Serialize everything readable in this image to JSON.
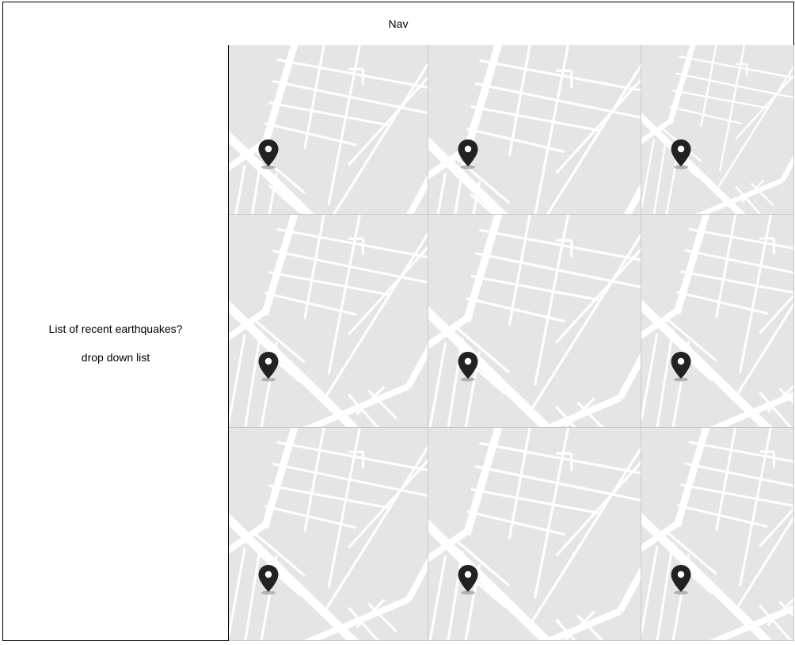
{
  "nav": {
    "label": "Nav"
  },
  "sidebar": {
    "title": "List of recent earthquakes?",
    "subtitle": "drop down list"
  },
  "map_grid": {
    "rows": 3,
    "cols": 3,
    "tiles": [
      {
        "icon": "map-pin-icon"
      },
      {
        "icon": "map-pin-icon"
      },
      {
        "icon": "map-pin-icon"
      },
      {
        "icon": "map-pin-icon"
      },
      {
        "icon": "map-pin-icon"
      },
      {
        "icon": "map-pin-icon"
      },
      {
        "icon": "map-pin-icon"
      },
      {
        "icon": "map-pin-icon"
      },
      {
        "icon": "map-pin-icon"
      }
    ]
  },
  "colors": {
    "map_background": "#e5e5e5",
    "road": "#ffffff",
    "pin": "#222222",
    "border": "#000000"
  }
}
